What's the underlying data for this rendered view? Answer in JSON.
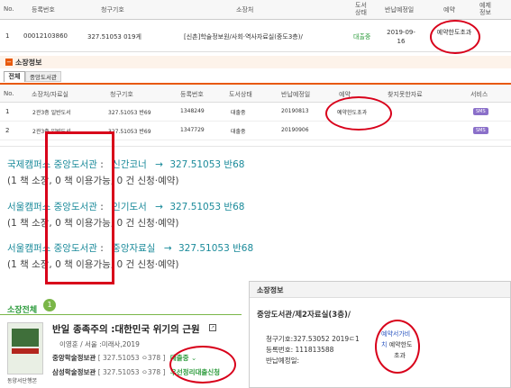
{
  "top_table": {
    "headers": [
      "No.",
      "등록번호",
      "청구기호",
      "소장처",
      "도서상태",
      "반납예정일",
      "예약",
      "예제정보"
    ],
    "row": {
      "no": "1",
      "reg": "00012103860",
      "call": "327.51053 019게",
      "location": "[신촌]학술정보원/사회·역사자료실(중도3층)/",
      "status": "대출중",
      "due": "2019-09-16",
      "reserve": "예약한도초과"
    }
  },
  "holdings_section": {
    "title": "소장정보",
    "tabs": [
      "전체",
      "중앙도서관"
    ],
    "headers": [
      "No.",
      "소장처/자료실",
      "청구기호",
      "등록번호",
      "도서상태",
      "반납예정일",
      "예약",
      "찾지못한자료",
      "서비스"
    ],
    "rows": [
      {
        "no": "1",
        "loc": "2관3층 일반도서",
        "call": "327.51053 반69",
        "reg": "1348249",
        "status": "대출중",
        "due": "20190813",
        "reserve": "예약한도초과",
        "service": "SMS"
      },
      {
        "no": "2",
        "loc": "2관3층 일반도서",
        "call": "327.51053 반69",
        "reg": "1347729",
        "status": "대출중",
        "due": "20190906",
        "reserve": "",
        "service": "SMS"
      }
    ]
  },
  "campus_list": [
    {
      "campus": "국제캠퍼스 중앙도서관",
      "sep": ":",
      "room": "신간코너",
      "arrow": "→",
      "call": "327.51053 반68",
      "summary": "(1 책 소장, 0 책 이용가능, 0 건 신청·예약)"
    },
    {
      "campus": "서울캠퍼스 중앙도서관",
      "sep": ":",
      "room": "인기도서",
      "arrow": "→",
      "call": "327.51053 반68",
      "summary": "(1 책 소장, 0 책 이용가능, 0 건 신청·예약)"
    },
    {
      "campus": "서울캠퍼스 중앙도서관",
      "sep": ":",
      "room": "중앙자료실",
      "arrow": "→",
      "call": "327.51053 반68",
      "summary": "(1 책 소장, 0 책 이용가능, 0 건 신청·예약)"
    }
  ],
  "bottom_left": {
    "tab_label": "소장전체",
    "count": "1",
    "book_title": "반일 종족주의 :대한민국 위기의 근원",
    "author_line": "이영훈 / 서울 :미래사,2019",
    "cover_caption": "동양서단행본",
    "holdings": [
      {
        "lib": "중앙학술정보관",
        "call": "[ 327.51053 ㅇ378 ]",
        "status": "대출중"
      },
      {
        "lib": "삼성학술정보관",
        "call": "[ 327.51053 ㅇ378 ]",
        "status": "우선정리대출신청"
      }
    ]
  },
  "bottom_right": {
    "title": "소장정보",
    "location": "중앙도서관/제2자료실(3층)/",
    "call_line": "청구기호:327.53052 2019ㄷ1",
    "reg_line": "등록번호: 111813588",
    "due_line": "반납예정일:",
    "reserve_lines": [
      "예약서가비",
      "치",
      "예약한도",
      "초과"
    ]
  },
  "colors": {
    "annotation_red": "#d8001a",
    "status_green": "#2a9a3a",
    "link_blue": "#2a6fc0",
    "campus_teal": "#1a8a9a",
    "section_orange": "#e8590c"
  }
}
